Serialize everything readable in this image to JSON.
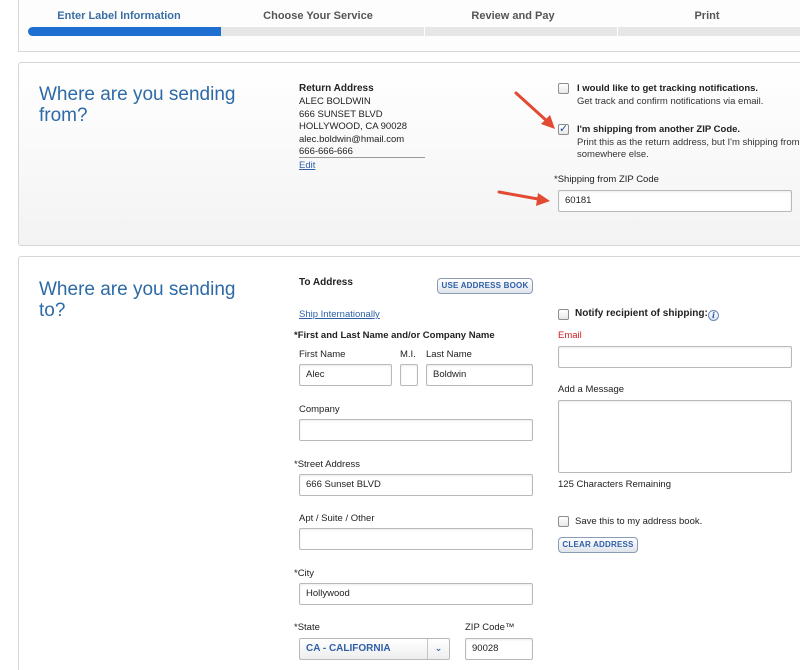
{
  "steps": [
    "Enter Label Information",
    "Choose Your Service",
    "Review and Pay",
    "Print"
  ],
  "from": {
    "heading": "Where are you sending from?",
    "return_title": "Return Address",
    "return_lines": [
      "ALEC BOLDWIN",
      "666 SUNSET BLVD",
      "HOLLYWOOD, CA 90028",
      "alec.boldwin@hmail.com",
      "666-666-666"
    ],
    "edit_link": "Edit",
    "tracking_label": "I would like to get tracking notifications.",
    "tracking_sub": "Get track and confirm notifications via email.",
    "other_zip_label": "I'm shipping from another ZIP Code.",
    "other_zip_sub1": "Print this as the return address, but I'm shipping from",
    "other_zip_sub2": "somewhere else.",
    "zip_label": "*Shipping from ZIP Code",
    "zip_value": "60181"
  },
  "to": {
    "heading": "Where are you sending to?",
    "to_title": "To Address",
    "use_address_book": "USE ADDRESS BOOK",
    "ship_intl": "Ship Internationally",
    "name_required": "*First and Last Name and/or Company Name",
    "first_name_label": "First Name",
    "mi_label": "M.I.",
    "last_name_label": "Last Name",
    "first_name": "Alec",
    "mi": "",
    "last_name": "Boldwin",
    "company_label": "Company",
    "company": "",
    "street_label": "*Street Address",
    "street": "666 Sunset BLVD",
    "apt_label": "Apt / Suite / Other",
    "apt": "",
    "city_label": "*City",
    "city": "Hollywood",
    "state_label": "*State",
    "state": "CA - CALIFORNIA",
    "zip_label": "ZIP Code™",
    "zip": "90028",
    "notify_label": "Notify recipient of shipping:",
    "email_label": "Email",
    "message_label": "Add a Message",
    "chars_remaining": "125 Characters Remaining",
    "save_label": "Save this to my address book.",
    "clear_address": "CLEAR ADDRESS"
  },
  "colors": {
    "accent": "#1f6fd0",
    "heading": "#2d6aa6",
    "arrow": "#e24a33",
    "required": "#cc2222"
  }
}
